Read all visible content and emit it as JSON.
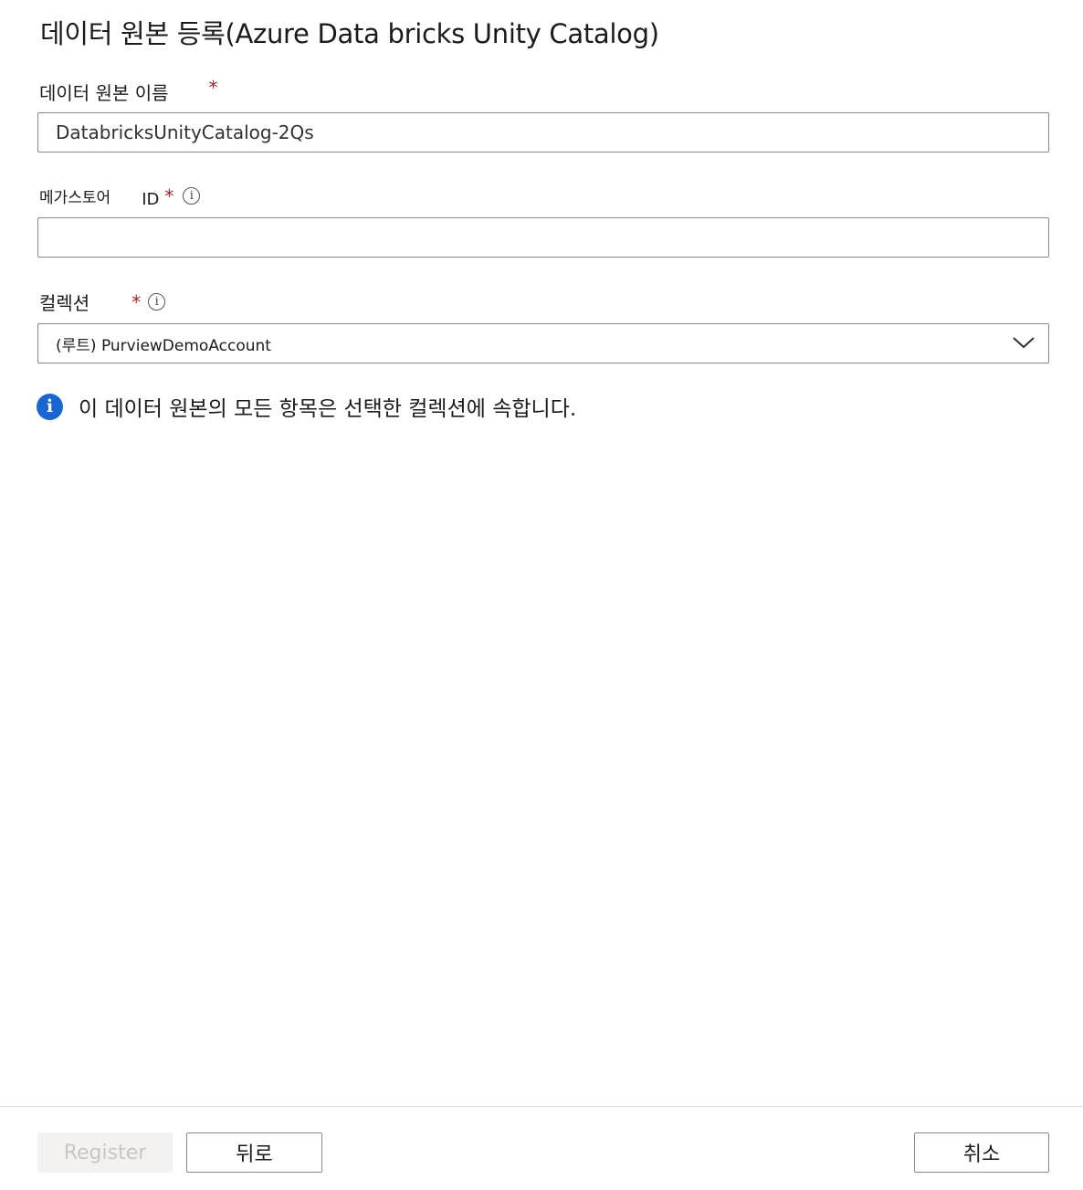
{
  "page": {
    "title": "데이터 원본 등록(Azure Data bricks Unity Catalog)"
  },
  "form": {
    "name": {
      "label": "데이터 원본 이름",
      "required_mark": "*",
      "value": "DatabricksUnityCatalog-2Qs"
    },
    "metastore": {
      "label_prefix": "메가스토어",
      "label_suffix": "ID",
      "required_mark": "*",
      "info_icon": "info-icon",
      "value": ""
    },
    "collection": {
      "label": "컬렉션",
      "required_mark": "*",
      "info_icon": "info-icon",
      "selected": "(루트) PurviewDemoAccount"
    }
  },
  "info_banner": {
    "icon": "info-icon",
    "text": "이 데이터 원본의 모든 항목은 선택한 컬렉션에 속합니다."
  },
  "footer": {
    "register_label": "Register",
    "back_label": "뒤로",
    "cancel_label": "취소"
  },
  "colors": {
    "required": "#a4262c",
    "info_blue": "#1a66d1",
    "border": "#8a8886",
    "disabled_text": "#c8c6c4"
  }
}
